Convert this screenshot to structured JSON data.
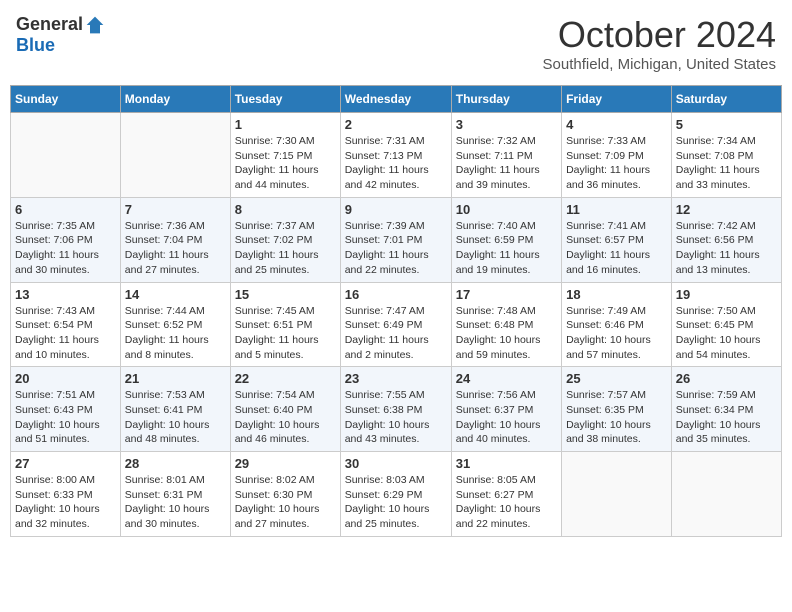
{
  "logo": {
    "general": "General",
    "blue": "Blue"
  },
  "title": "October 2024",
  "subtitle": "Southfield, Michigan, United States",
  "days_of_week": [
    "Sunday",
    "Monday",
    "Tuesday",
    "Wednesday",
    "Thursday",
    "Friday",
    "Saturday"
  ],
  "weeks": [
    [
      {
        "day": "",
        "info": ""
      },
      {
        "day": "",
        "info": ""
      },
      {
        "day": "1",
        "sunrise": "Sunrise: 7:30 AM",
        "sunset": "Sunset: 7:15 PM",
        "daylight": "Daylight: 11 hours and 44 minutes."
      },
      {
        "day": "2",
        "sunrise": "Sunrise: 7:31 AM",
        "sunset": "Sunset: 7:13 PM",
        "daylight": "Daylight: 11 hours and 42 minutes."
      },
      {
        "day": "3",
        "sunrise": "Sunrise: 7:32 AM",
        "sunset": "Sunset: 7:11 PM",
        "daylight": "Daylight: 11 hours and 39 minutes."
      },
      {
        "day": "4",
        "sunrise": "Sunrise: 7:33 AM",
        "sunset": "Sunset: 7:09 PM",
        "daylight": "Daylight: 11 hours and 36 minutes."
      },
      {
        "day": "5",
        "sunrise": "Sunrise: 7:34 AM",
        "sunset": "Sunset: 7:08 PM",
        "daylight": "Daylight: 11 hours and 33 minutes."
      }
    ],
    [
      {
        "day": "6",
        "sunrise": "Sunrise: 7:35 AM",
        "sunset": "Sunset: 7:06 PM",
        "daylight": "Daylight: 11 hours and 30 minutes."
      },
      {
        "day": "7",
        "sunrise": "Sunrise: 7:36 AM",
        "sunset": "Sunset: 7:04 PM",
        "daylight": "Daylight: 11 hours and 27 minutes."
      },
      {
        "day": "8",
        "sunrise": "Sunrise: 7:37 AM",
        "sunset": "Sunset: 7:02 PM",
        "daylight": "Daylight: 11 hours and 25 minutes."
      },
      {
        "day": "9",
        "sunrise": "Sunrise: 7:39 AM",
        "sunset": "Sunset: 7:01 PM",
        "daylight": "Daylight: 11 hours and 22 minutes."
      },
      {
        "day": "10",
        "sunrise": "Sunrise: 7:40 AM",
        "sunset": "Sunset: 6:59 PM",
        "daylight": "Daylight: 11 hours and 19 minutes."
      },
      {
        "day": "11",
        "sunrise": "Sunrise: 7:41 AM",
        "sunset": "Sunset: 6:57 PM",
        "daylight": "Daylight: 11 hours and 16 minutes."
      },
      {
        "day": "12",
        "sunrise": "Sunrise: 7:42 AM",
        "sunset": "Sunset: 6:56 PM",
        "daylight": "Daylight: 11 hours and 13 minutes."
      }
    ],
    [
      {
        "day": "13",
        "sunrise": "Sunrise: 7:43 AM",
        "sunset": "Sunset: 6:54 PM",
        "daylight": "Daylight: 11 hours and 10 minutes."
      },
      {
        "day": "14",
        "sunrise": "Sunrise: 7:44 AM",
        "sunset": "Sunset: 6:52 PM",
        "daylight": "Daylight: 11 hours and 8 minutes."
      },
      {
        "day": "15",
        "sunrise": "Sunrise: 7:45 AM",
        "sunset": "Sunset: 6:51 PM",
        "daylight": "Daylight: 11 hours and 5 minutes."
      },
      {
        "day": "16",
        "sunrise": "Sunrise: 7:47 AM",
        "sunset": "Sunset: 6:49 PM",
        "daylight": "Daylight: 11 hours and 2 minutes."
      },
      {
        "day": "17",
        "sunrise": "Sunrise: 7:48 AM",
        "sunset": "Sunset: 6:48 PM",
        "daylight": "Daylight: 10 hours and 59 minutes."
      },
      {
        "day": "18",
        "sunrise": "Sunrise: 7:49 AM",
        "sunset": "Sunset: 6:46 PM",
        "daylight": "Daylight: 10 hours and 57 minutes."
      },
      {
        "day": "19",
        "sunrise": "Sunrise: 7:50 AM",
        "sunset": "Sunset: 6:45 PM",
        "daylight": "Daylight: 10 hours and 54 minutes."
      }
    ],
    [
      {
        "day": "20",
        "sunrise": "Sunrise: 7:51 AM",
        "sunset": "Sunset: 6:43 PM",
        "daylight": "Daylight: 10 hours and 51 minutes."
      },
      {
        "day": "21",
        "sunrise": "Sunrise: 7:53 AM",
        "sunset": "Sunset: 6:41 PM",
        "daylight": "Daylight: 10 hours and 48 minutes."
      },
      {
        "day": "22",
        "sunrise": "Sunrise: 7:54 AM",
        "sunset": "Sunset: 6:40 PM",
        "daylight": "Daylight: 10 hours and 46 minutes."
      },
      {
        "day": "23",
        "sunrise": "Sunrise: 7:55 AM",
        "sunset": "Sunset: 6:38 PM",
        "daylight": "Daylight: 10 hours and 43 minutes."
      },
      {
        "day": "24",
        "sunrise": "Sunrise: 7:56 AM",
        "sunset": "Sunset: 6:37 PM",
        "daylight": "Daylight: 10 hours and 40 minutes."
      },
      {
        "day": "25",
        "sunrise": "Sunrise: 7:57 AM",
        "sunset": "Sunset: 6:35 PM",
        "daylight": "Daylight: 10 hours and 38 minutes."
      },
      {
        "day": "26",
        "sunrise": "Sunrise: 7:59 AM",
        "sunset": "Sunset: 6:34 PM",
        "daylight": "Daylight: 10 hours and 35 minutes."
      }
    ],
    [
      {
        "day": "27",
        "sunrise": "Sunrise: 8:00 AM",
        "sunset": "Sunset: 6:33 PM",
        "daylight": "Daylight: 10 hours and 32 minutes."
      },
      {
        "day": "28",
        "sunrise": "Sunrise: 8:01 AM",
        "sunset": "Sunset: 6:31 PM",
        "daylight": "Daylight: 10 hours and 30 minutes."
      },
      {
        "day": "29",
        "sunrise": "Sunrise: 8:02 AM",
        "sunset": "Sunset: 6:30 PM",
        "daylight": "Daylight: 10 hours and 27 minutes."
      },
      {
        "day": "30",
        "sunrise": "Sunrise: 8:03 AM",
        "sunset": "Sunset: 6:29 PM",
        "daylight": "Daylight: 10 hours and 25 minutes."
      },
      {
        "day": "31",
        "sunrise": "Sunrise: 8:05 AM",
        "sunset": "Sunset: 6:27 PM",
        "daylight": "Daylight: 10 hours and 22 minutes."
      },
      {
        "day": "",
        "info": ""
      },
      {
        "day": "",
        "info": ""
      }
    ]
  ]
}
